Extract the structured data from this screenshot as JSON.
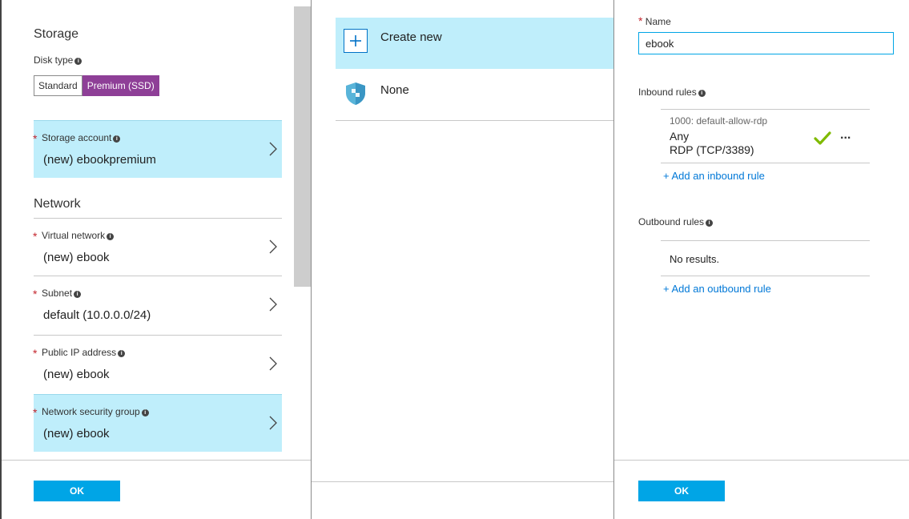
{
  "settings_blade": {
    "storage_title": "Storage",
    "disk_type_label": "Disk type",
    "disk_type_options": [
      "Standard",
      "Premium (SSD)"
    ],
    "disk_type_selected": "Premium (SSD)",
    "storage_account": {
      "label": "Storage account",
      "value": "(new) ebookpremium"
    },
    "network_title": "Network",
    "virtual_network": {
      "label": "Virtual network",
      "value": "(new) ebook"
    },
    "subnet": {
      "label": "Subnet",
      "value": "default (10.0.0.0/24)"
    },
    "public_ip": {
      "label": "Public IP address",
      "value": "(new) ebook"
    },
    "nsg": {
      "label": "Network security group",
      "value": "(new) ebook"
    },
    "ok_label": "OK"
  },
  "choose_nsg_blade": {
    "create_new_label": "Create new",
    "none_label": "None"
  },
  "create_nsg_blade": {
    "name_label": "Name",
    "name_value": "ebook",
    "inbound_label": "Inbound rules",
    "inbound_rule": {
      "name": "1000: default-allow-rdp",
      "source": "Any",
      "service": "RDP (TCP/3389)",
      "more": "..."
    },
    "add_inbound_label": "+ Add an inbound rule",
    "outbound_label": "Outbound rules",
    "outbound_empty": "No results.",
    "add_outbound_label": "+ Add an outbound rule",
    "ok_label": "OK"
  },
  "colors": {
    "accent": "#00a5e6",
    "selected_row": "#bfeefb",
    "premium_toggle": "#8e3f97",
    "required_star": "#c4262e",
    "check": "#7fba00",
    "link": "#0078d7"
  }
}
